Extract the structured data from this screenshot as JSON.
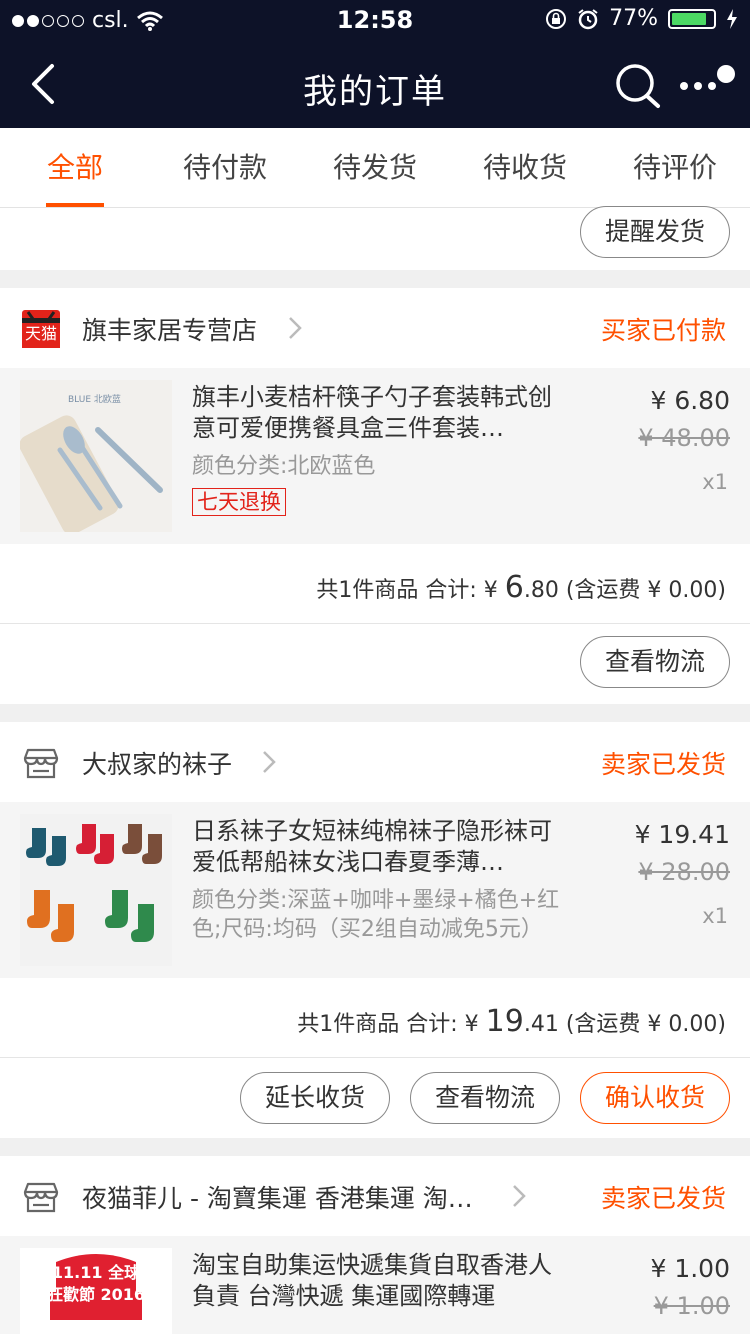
{
  "status_bar": {
    "carrier": "csl.",
    "time": "12:58",
    "battery": "77%",
    "battery_level": 0.77
  },
  "header": {
    "title": "我的订单"
  },
  "tabs": [
    {
      "label": "全部",
      "active": true
    },
    {
      "label": "待付款",
      "active": false
    },
    {
      "label": "待发货",
      "active": false
    },
    {
      "label": "待收货",
      "active": false
    },
    {
      "label": "待评价",
      "active": false
    }
  ],
  "remind_button": "提醒发货",
  "orders": [
    {
      "shop_name": "旗丰家居专营店",
      "shop_badge": "天猫",
      "status": "买家已付款",
      "item_title": "旗丰小麦桔杆筷子勺子套装韩式创意可爱便携餐具盒三件套装…",
      "item_spec": "颜色分类:北欧蓝色",
      "item_badge": "七天退换",
      "thumb_label": "BLUE 北欧蓝",
      "price": "¥ 6.80",
      "original_price": "¥ 48.00",
      "quantity": "x1",
      "summary_prefix": "共1件商品 合计: ¥ ",
      "summary_int": "6",
      "summary_dec": ".80",
      "summary_shipping": " (含运费 ¥ 0.00)",
      "buttons": [
        "查看物流"
      ]
    },
    {
      "shop_name": "大叔家的袜子",
      "status": "卖家已发货",
      "item_title": "日系袜子女短袜纯棉袜子隐形袜可爱低帮船袜女浅口春夏季薄…",
      "item_spec": "颜色分类:深蓝+咖啡+墨绿+橘色+红色;尺码:均码（买2组自动减免5元）",
      "price": "¥ 19.41",
      "original_price": "¥ 28.00",
      "quantity": "x1",
      "summary_prefix": "共1件商品 合计: ¥ ",
      "summary_int": "19",
      "summary_dec": ".41",
      "summary_shipping": " (含运费 ¥ 0.00)",
      "buttons": [
        "延长收货",
        "查看物流",
        "确认收货"
      ]
    },
    {
      "shop_name": "夜猫菲儿 - 淘寶集運 香港集運 淘…",
      "status": "卖家已发货",
      "item_title": "淘宝自助集运快遞集貨自取香港人負責 台灣快遞 集運國際轉運",
      "thumb_label": "11.11 全球狂歡節 2016",
      "price": "¥ 1.00",
      "original_price": "¥ 1.00"
    }
  ],
  "colors": {
    "accent": "#ff5000",
    "header_bg": "#0d1228",
    "badge_red": "#e2231a"
  }
}
